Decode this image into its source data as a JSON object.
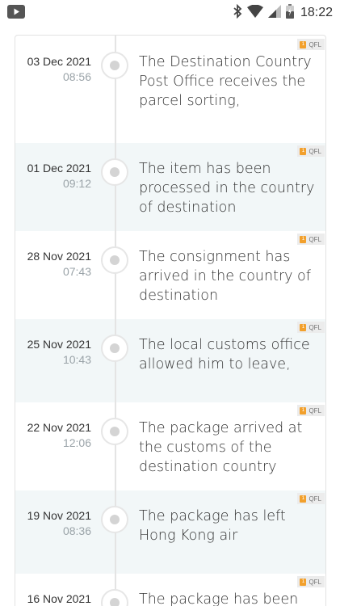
{
  "status_bar": {
    "app_icon": "play-icon",
    "bluetooth_icon": "bluetooth-icon",
    "wifi_icon": "wifi-icon",
    "signal_icon": "cell-signal-icon",
    "battery_icon": "battery-icon",
    "time": "18:22"
  },
  "tracking": {
    "events": [
      {
        "date": "03 Dec 2021",
        "time": "08:56",
        "description": "The Destination Country Post Office receives the parcel sorting,",
        "source": "QFL"
      },
      {
        "date": "01 Dec 2021",
        "time": "09:12",
        "description": "The item has been processed in the country of destination",
        "source": "QFL"
      },
      {
        "date": "28 Nov 2021",
        "time": "07:43",
        "description": "The consignment has arrived in the country of destination",
        "source": "QFL"
      },
      {
        "date": "25 Nov 2021",
        "time": "10:43",
        "description": "The local customs office allowed him to leave,",
        "source": "QFL"
      },
      {
        "date": "22 Nov 2021",
        "time": "12:06",
        "description": "The package arrived at the customs of the destination country",
        "source": "QFL"
      },
      {
        "date": "19 Nov 2021",
        "time": "08:36",
        "description": "The package has left Hong Kong air",
        "source": "QFL"
      },
      {
        "date": "16 Nov 2021",
        "time": "",
        "description": "The package has been",
        "source": "QFL"
      }
    ]
  },
  "colors": {
    "alt_row_bg": "#f2f7f8",
    "badge_accent": "#f2a02c",
    "time_text": "#9aa3a8"
  }
}
